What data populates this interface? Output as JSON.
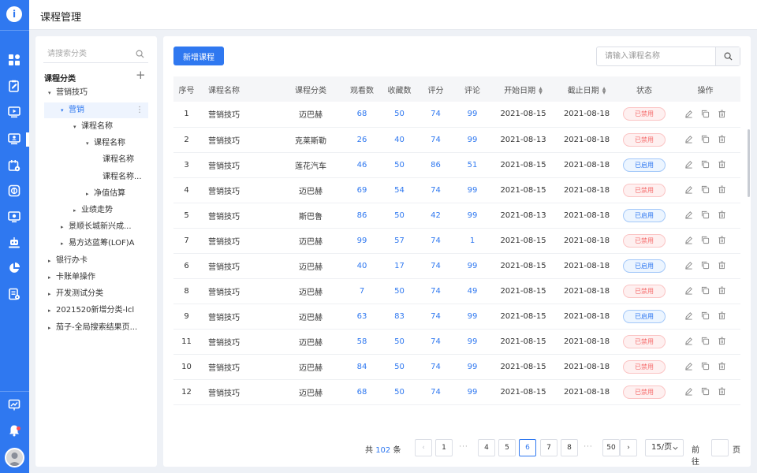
{
  "header": {
    "title": "课程管理"
  },
  "rail": {
    "icons": [
      "dashboard-icon",
      "clipboard-edit-icon",
      "monitor-play-icon",
      "monitor-user-icon",
      "calendar-settings-icon",
      "coin-icon",
      "screen-report-icon",
      "robot-icon",
      "pie-chart-icon",
      "document-settings-icon"
    ],
    "bottom_icons": [
      "presentation-icon",
      "bell-icon",
      "avatar"
    ]
  },
  "tree": {
    "search_placeholder": "请搜索分类",
    "header": "课程分类",
    "nodes": [
      {
        "label": "营销技巧",
        "arrow": "▾"
      },
      {
        "label": "营销",
        "arrow": "▾",
        "selected": true
      },
      {
        "label": "课程名称",
        "arrow": "▾"
      },
      {
        "label": "课程名称",
        "arrow": "▾"
      },
      {
        "label": "课程名称",
        "arrow": ""
      },
      {
        "label": "课程名称...",
        "arrow": ""
      },
      {
        "label": "净值估算",
        "arrow": "▸"
      },
      {
        "label": "业绩走势",
        "arrow": "▸"
      },
      {
        "label": "景顺长城新兴成...",
        "arrow": "▸"
      },
      {
        "label": "易方达蓝筹(LOF)A",
        "arrow": "▸"
      },
      {
        "label": "银行办卡",
        "arrow": "▸"
      },
      {
        "label": "卡账单操作",
        "arrow": "▸"
      },
      {
        "label": "开发测试分类",
        "arrow": "▸"
      },
      {
        "label": "2021520新增分类-lcl",
        "arrow": "▸"
      },
      {
        "label": "茄子-全局搜索结果页...",
        "arrow": "▸"
      }
    ]
  },
  "toolbar": {
    "add_label": "新增课程",
    "search_placeholder": "请输入课程名称"
  },
  "table": {
    "headers": {
      "seq": "序号",
      "name": "课程名称",
      "category": "课程分类",
      "views": "观看数",
      "favorites": "收藏数",
      "score": "评分",
      "comments": "评论",
      "start": "开始日期",
      "end": "截止日期",
      "status": "状态",
      "ops": "操作"
    },
    "rows": [
      {
        "seq": "1",
        "name": "营销技巧",
        "category": "迈巴赫",
        "views": "68",
        "favorites": "50",
        "score": "74",
        "comments": "99",
        "start": "2021-08-15",
        "end": "2021-08-18",
        "status": "已禁用",
        "status_type": "off"
      },
      {
        "seq": "2",
        "name": "营销技巧",
        "category": "克莱斯勒",
        "views": "26",
        "favorites": "40",
        "score": "74",
        "comments": "99",
        "start": "2021-08-13",
        "end": "2021-08-18",
        "status": "已禁用",
        "status_type": "off"
      },
      {
        "seq": "3",
        "name": "营销技巧",
        "category": "莲花汽车",
        "views": "46",
        "favorites": "50",
        "score": "86",
        "comments": "51",
        "start": "2021-08-15",
        "end": "2021-08-18",
        "status": "已启用",
        "status_type": "on"
      },
      {
        "seq": "4",
        "name": "营销技巧",
        "category": "迈巴赫",
        "views": "69",
        "favorites": "54",
        "score": "74",
        "comments": "99",
        "start": "2021-08-15",
        "end": "2021-08-18",
        "status": "已禁用",
        "status_type": "off"
      },
      {
        "seq": "5",
        "name": "营销技巧",
        "category": "斯巴鲁",
        "views": "86",
        "favorites": "50",
        "score": "42",
        "comments": "99",
        "start": "2021-08-13",
        "end": "2021-08-18",
        "status": "已启用",
        "status_type": "on"
      },
      {
        "seq": "7",
        "name": "营销技巧",
        "category": "迈巴赫",
        "views": "99",
        "favorites": "57",
        "score": "74",
        "comments": "1",
        "start": "2021-08-15",
        "end": "2021-08-18",
        "status": "已禁用",
        "status_type": "off"
      },
      {
        "seq": "6",
        "name": "营销技巧",
        "category": "迈巴赫",
        "views": "40",
        "favorites": "17",
        "score": "74",
        "comments": "99",
        "start": "2021-08-15",
        "end": "2021-08-18",
        "status": "已启用",
        "status_type": "on"
      },
      {
        "seq": "8",
        "name": "营销技巧",
        "category": "迈巴赫",
        "views": "7",
        "favorites": "50",
        "score": "74",
        "comments": "49",
        "start": "2021-08-15",
        "end": "2021-08-18",
        "status": "已禁用",
        "status_type": "off"
      },
      {
        "seq": "9",
        "name": "营销技巧",
        "category": "迈巴赫",
        "views": "63",
        "favorites": "83",
        "score": "74",
        "comments": "99",
        "start": "2021-08-15",
        "end": "2021-08-18",
        "status": "已启用",
        "status_type": "on"
      },
      {
        "seq": "11",
        "name": "营销技巧",
        "category": "迈巴赫",
        "views": "58",
        "favorites": "50",
        "score": "74",
        "comments": "99",
        "start": "2021-08-15",
        "end": "2021-08-18",
        "status": "已禁用",
        "status_type": "off"
      },
      {
        "seq": "10",
        "name": "营销技巧",
        "category": "迈巴赫",
        "views": "84",
        "favorites": "50",
        "score": "74",
        "comments": "99",
        "start": "2021-08-15",
        "end": "2021-08-18",
        "status": "已禁用",
        "status_type": "off"
      },
      {
        "seq": "12",
        "name": "营销技巧",
        "category": "迈巴赫",
        "views": "68",
        "favorites": "50",
        "score": "74",
        "comments": "99",
        "start": "2021-08-15",
        "end": "2021-08-18",
        "status": "已禁用",
        "status_type": "off"
      }
    ],
    "row_action_icons": [
      "edit-icon",
      "copy-icon",
      "delete-icon"
    ]
  },
  "pagination": {
    "total_prefix": "共",
    "total": "102",
    "total_suffix": "条",
    "prev": "‹",
    "next": "›",
    "pages": [
      "1",
      "···",
      "4",
      "5",
      "6",
      "7",
      "8",
      "···",
      "50"
    ],
    "current": "6",
    "page_size": "15/页",
    "goto_label": "前往",
    "goto_suffix": "页"
  },
  "colors": {
    "primary": "#2f78f0",
    "danger": "#f56c6c",
    "background": "#eef1f6"
  }
}
